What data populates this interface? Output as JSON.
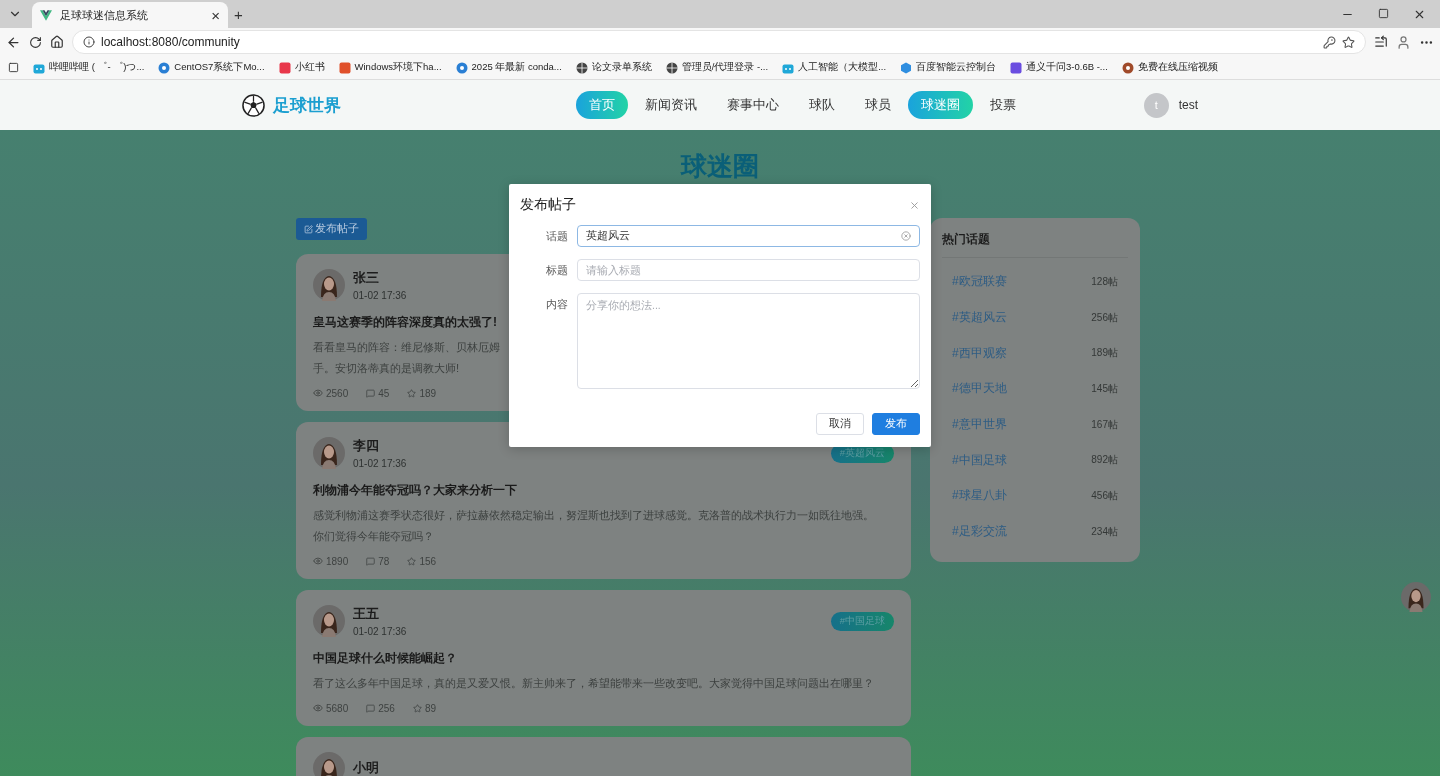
{
  "browser": {
    "tab": {
      "title": "足球球迷信息系统",
      "close": "×"
    },
    "new_tab": "+",
    "url": "localhost:8080/community",
    "bookmarks": [
      {
        "kind": "tv",
        "color": "#20a8d8",
        "label": "哔哩哔哩 ( ゜- ゜)つ..."
      },
      {
        "kind": "disc",
        "color": "#2a7fd4",
        "label": "CentOS7系统下Mo..."
      },
      {
        "kind": "square",
        "color": "#e8374a",
        "label": "小红书"
      },
      {
        "kind": "square",
        "color": "#e0502a",
        "label": "Windows环境下ha..."
      },
      {
        "kind": "disc",
        "color": "#2a7fd4",
        "label": "2025 年最新 conda..."
      },
      {
        "kind": "globe",
        "color": "#444444",
        "label": "论文录单系统"
      },
      {
        "kind": "globe",
        "color": "#444444",
        "label": "管理员/代理登录 -..."
      },
      {
        "kind": "tv",
        "color": "#20a8d8",
        "label": "人工智能（大模型..."
      },
      {
        "kind": "hex",
        "color": "#2f8ee0",
        "label": "百度智能云控制台"
      },
      {
        "kind": "square",
        "color": "#6a4de0",
        "label": "通义千问3-0.6B -..."
      },
      {
        "kind": "disc",
        "color": "#a04a2a",
        "label": "免费在线压缩视频"
      }
    ]
  },
  "header": {
    "logo": "足球世界",
    "nav": [
      {
        "label": "首页",
        "selected": true
      },
      {
        "label": "新闻资讯",
        "selected": false
      },
      {
        "label": "赛事中心",
        "selected": false
      },
      {
        "label": "球队",
        "selected": false
      },
      {
        "label": "球员",
        "selected": false
      },
      {
        "label": "球迷圈",
        "selected": true
      },
      {
        "label": "投票",
        "selected": false
      }
    ],
    "user": {
      "initial": "t",
      "name": "test"
    }
  },
  "page_title": "球迷圈",
  "publish_button": "发布帖子",
  "posts": [
    {
      "author": "张三",
      "time": "01-02 17:36",
      "title": "皇马这赛季的阵容深度真的太强了!",
      "lines": [
        "看看皇马的阵容：维尼修斯、贝林厄姆",
        "手。安切洛蒂真的是调教大师!"
      ],
      "views": "2560",
      "comments": "45",
      "likes": "189"
    },
    {
      "author": "李四",
      "time": "01-02 17:36",
      "tag": "#英超风云",
      "title": "利物浦今年能夺冠吗？大家来分析一下",
      "lines": [
        "感觉利物浦这赛季状态很好，萨拉赫依然稳定输出，努涅斯也找到了进球感觉。克洛普的战术执行力一如既往地强。",
        "你们觉得今年能夺冠吗？"
      ],
      "views": "1890",
      "comments": "78",
      "likes": "156"
    },
    {
      "author": "王五",
      "time": "01-02 17:36",
      "tag": "#中国足球",
      "title": "中国足球什么时候能崛起？",
      "lines": [
        "看了这么多年中国足球，真的是又爱又恨。新主帅来了，希望能带来一些改变吧。大家觉得中国足球问题出在哪里？"
      ],
      "views": "5680",
      "comments": "256",
      "likes": "89"
    },
    {
      "author": "小明"
    }
  ],
  "hot_topics": {
    "title": "热门话题",
    "items": [
      {
        "name": "#欧冠联赛",
        "count": "128帖"
      },
      {
        "name": "#英超风云",
        "count": "256帖"
      },
      {
        "name": "#西甲观察",
        "count": "189帖"
      },
      {
        "name": "#德甲天地",
        "count": "145帖"
      },
      {
        "name": "#意甲世界",
        "count": "167帖"
      },
      {
        "name": "#中国足球",
        "count": "892帖"
      },
      {
        "name": "#球星八卦",
        "count": "456帖"
      },
      {
        "name": "#足彩交流",
        "count": "234帖"
      }
    ]
  },
  "dialog": {
    "title": "发布帖子",
    "fields": [
      {
        "kind": "input",
        "label": "话题",
        "value": "英超风云"
      },
      {
        "kind": "input",
        "label": "标题",
        "placeholder": "请输入标题"
      },
      {
        "kind": "textarea",
        "label": "内容",
        "placeholder": "分享你的想法..."
      }
    ],
    "buttons": [
      {
        "label": "取消",
        "kind": "secondary"
      },
      {
        "label": "发布",
        "kind": "primary"
      }
    ]
  }
}
